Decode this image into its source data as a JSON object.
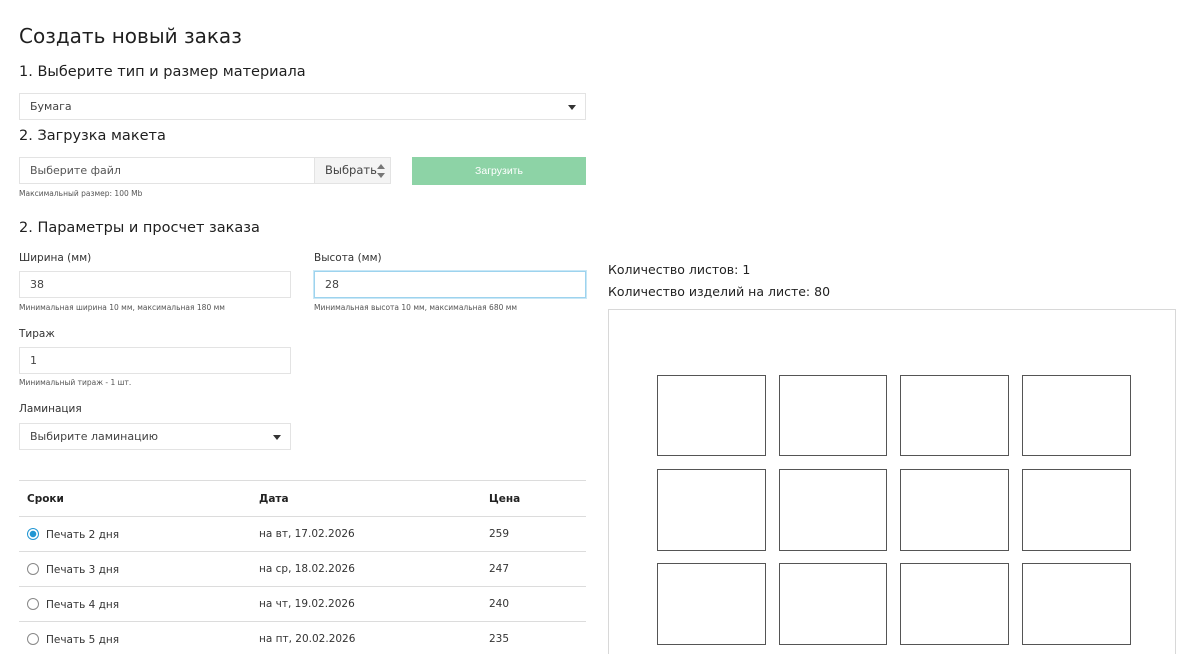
{
  "page": {
    "title": "Создать новый заказ"
  },
  "material": {
    "heading": "1. Выберите тип и размер материала",
    "selected": "Бумага"
  },
  "upload": {
    "heading": "2. Загрузка макета",
    "file_placeholder": "Выберите файл",
    "browse_label": "Выбрать",
    "upload_button": "Загрузить",
    "max_size_hint": "Максимальный размер: 100 Mb",
    "button_color": "#8dd3a6"
  },
  "params": {
    "heading": "2. Параметры и просчет заказа",
    "width": {
      "label": "Ширина (мм)",
      "value": "38",
      "hint": "Минимальная ширина 10 мм, максимальная 180 мм"
    },
    "height": {
      "label": "Высота (мм)",
      "value": "28",
      "hint": "Минимальная высота 10 мм, максимальная 680 мм"
    },
    "run": {
      "label": "Тираж",
      "value": "1",
      "hint": "Минимальный тираж - 1 шт."
    },
    "lamination": {
      "label": "Ламинация",
      "selected": "Выбирите ламинацию"
    }
  },
  "terms_table": {
    "headers": [
      "Сроки",
      "Дата",
      "Цена"
    ],
    "rows": [
      {
        "term": "Печать 2 дня",
        "date": "на вт, 17.02.2026",
        "price": "259",
        "selected": true
      },
      {
        "term": "Печать 3 дня",
        "date": "на ср, 18.02.2026",
        "price": "247",
        "selected": false
      },
      {
        "term": "Печать 4 дня",
        "date": "на чт, 19.02.2026",
        "price": "240",
        "selected": false
      },
      {
        "term": "Печать 5 дня",
        "date": "на пт, 20.02.2026",
        "price": "235",
        "selected": false
      }
    ]
  },
  "summary": {
    "sheets": "Количество листов: 1",
    "items_per_sheet": "Количество изделий на листе: 80"
  },
  "colors": {
    "accent": "#2196d3",
    "focus": "#9dd3ee"
  }
}
